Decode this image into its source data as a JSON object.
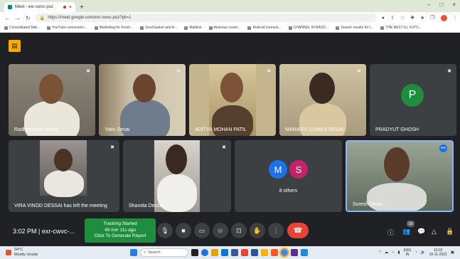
{
  "browser": {
    "tab_title": "Meet - exr-cwvc-puz",
    "tab_close": "×",
    "new_tab": "+",
    "url": "https://meet.google.com/exr-cwvc-puz?pli=1",
    "window_controls": [
      "–",
      "□",
      "×"
    ],
    "bookmarks": [
      "Consolidated Mat...",
      "YouTube connectors...",
      "Marketing for Fresh...",
      "Goal basket and A...",
      "Mailbox",
      "Alumnus Learn...",
      "Android connect...",
      "CHANNEL IN BASO...",
      "Search results for t...",
      "THE BEST EL FUTS..."
    ]
  },
  "meet": {
    "participants": [
      {
        "name": "Radheyshna Dubey",
        "muted": true
      },
      {
        "name": "Yatin Desai",
        "muted": true
      },
      {
        "name": "ADITYA MOHAN PATIL",
        "muted": true
      },
      {
        "name": "MANASVI GUNAJI DESAI",
        "muted": true
      },
      {
        "name": "PRADYUT GHOSH",
        "muted": true,
        "initial": "P"
      },
      {
        "name": "VIRA VINOD DESSAI has left the meeting",
        "muted": true
      },
      {
        "name": "Shamita Dessai",
        "muted": true
      },
      {
        "name": "8 others",
        "avatars": [
          "M",
          "S"
        ]
      },
      {
        "name": "Suresh Desai",
        "muted": false
      }
    ],
    "time": "3:02 PM",
    "separator": "|",
    "meeting_code": "exr-cwvc-...",
    "tracking": {
      "line1": "Tracking Started",
      "line2": "49 min 11s ago",
      "line3": "Click To Generate Report"
    },
    "participant_count": "16",
    "colors": {
      "pradyut": "#1e8e3e",
      "m_avatar": "#1a73e8",
      "s_avatar": "#c5226b",
      "tracking": "#1e8e3e",
      "end_call": "#ea4335",
      "meet_logo": "#f9ab00"
    }
  },
  "taskbar": {
    "temp": "34°C",
    "weather": "Mostly cloudy",
    "search_placeholder": "Search",
    "lang1": "ENG",
    "lang2": "IN",
    "clock_time": "15:02",
    "clock_date": "16-11-2021"
  }
}
